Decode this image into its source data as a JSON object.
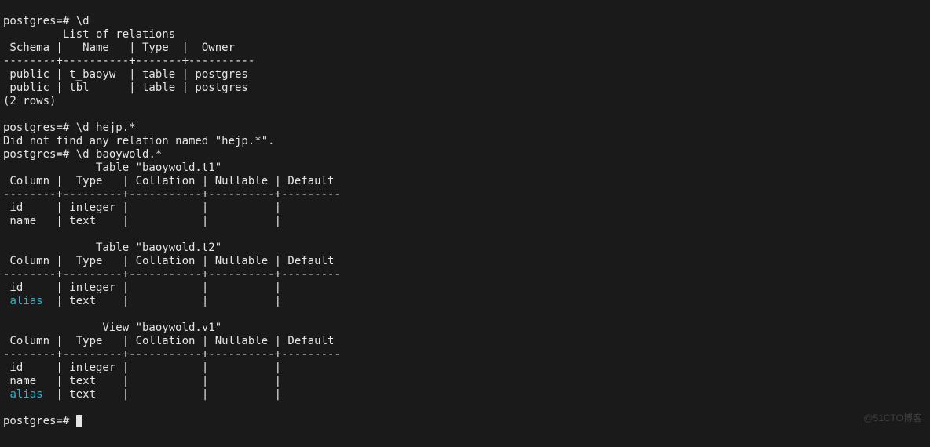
{
  "prompt": "postgres=#",
  "cmd1": "\\d",
  "rel_title": "         List of relations",
  "rel_hdr": " Schema |   Name   | Type  |  Owner",
  "rel_sep": "--------+----------+-------+----------",
  "rel_r1": " public | t_baoyw  | table | postgres",
  "rel_r2": " public | tbl      | table | postgres",
  "rel_count": "(2 rows)",
  "cmd2": "\\d hejp.*",
  "notfound": "Did not find any relation named \"hejp.*\".",
  "cmd3": "\\d baoywold.*",
  "t1_title": "              Table \"baoywold.t1\"",
  "col_hdr": " Column |  Type   | Collation | Nullable | Default",
  "col_sep": "--------+---------+-----------+----------+---------",
  "t1_r1": " id     | integer |           |          |",
  "t1_r2": " name   | text    |           |          |",
  "t2_title": "              Table \"baoywold.t2\"",
  "t2_r1": " id     | integer |           |          |",
  "t2_r2a": " ",
  "t2_r2b": "alias",
  "t2_r2c": "  | text    |           |          |",
  "v1_title": "               View \"baoywold.v1\"",
  "v1_r1": " id     | integer |           |          |",
  "v1_r2": " name   | text    |           |          |",
  "v1_r3a": " ",
  "v1_r3b": "alias",
  "v1_r3c": "  | text    |           |          |",
  "watermark": "@51CTO博客"
}
